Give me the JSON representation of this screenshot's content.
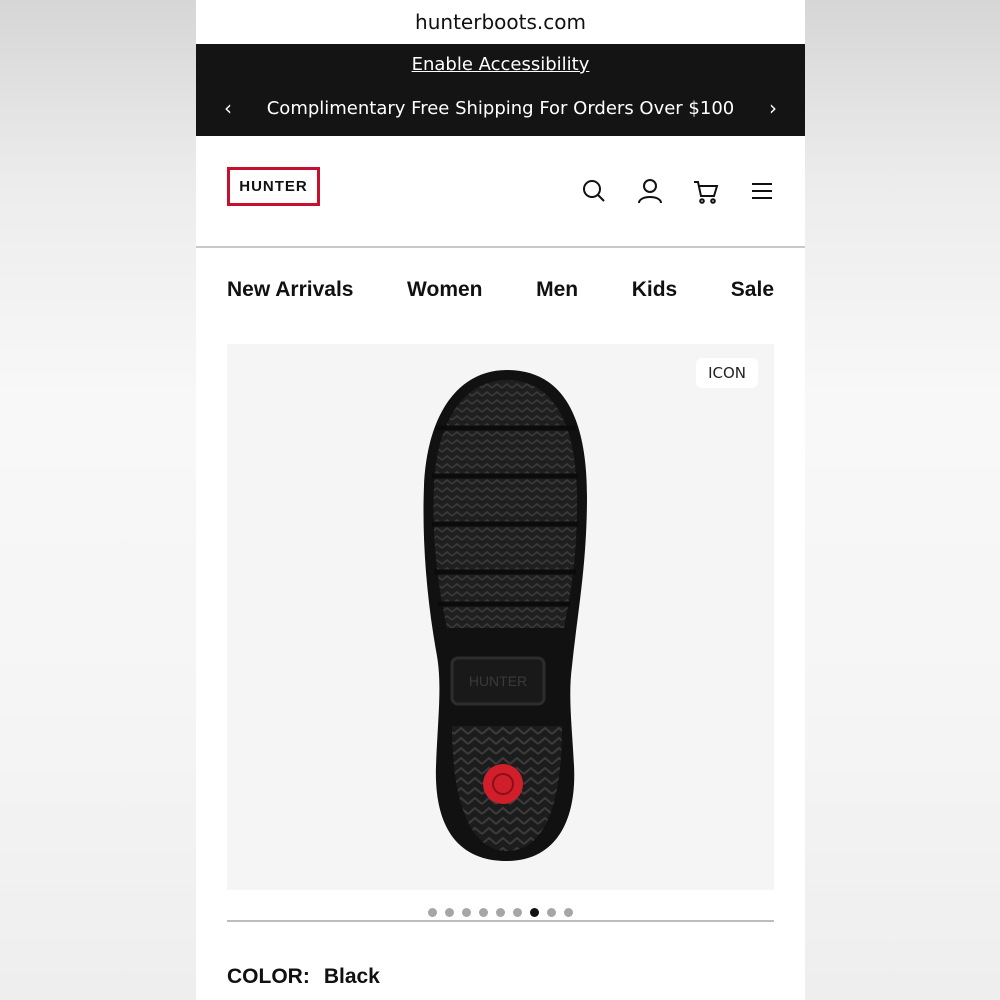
{
  "browser": {
    "url": "hunterboots.com"
  },
  "promo": {
    "accessibility_link": "Enable Accessibility",
    "shipping_message": "Complimentary Free Shipping For Orders Over $100",
    "prev_arrow": "‹",
    "next_arrow": "›"
  },
  "header": {
    "logo_text": "HUNTER",
    "logo_color": "#c8102e",
    "icons": [
      "search-icon",
      "account-icon",
      "cart-icon",
      "menu-icon"
    ]
  },
  "nav": {
    "items": [
      "New Arrivals",
      "Women",
      "Men",
      "Kids",
      "Sale"
    ]
  },
  "product": {
    "badge": "ICON",
    "image_dots_count": 9,
    "active_dot_index": 6,
    "color_label": "COLOR:",
    "color_value": "Black"
  }
}
